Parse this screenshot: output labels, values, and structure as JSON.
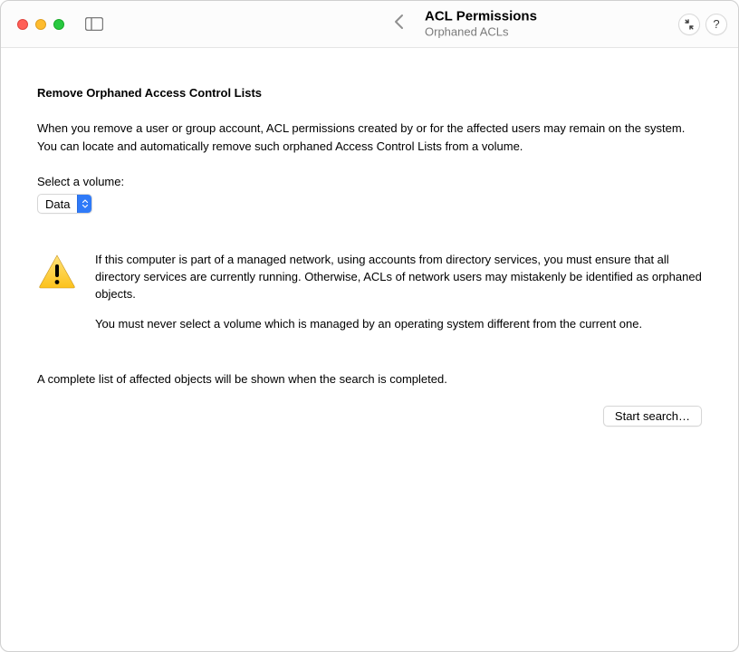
{
  "window": {
    "title": "ACL Permissions",
    "subtitle": "Orphaned ACLs"
  },
  "content": {
    "heading": "Remove Orphaned Access Control Lists",
    "intro": "When you remove a user or group account, ACL permissions created by or for the affected users may remain on the system. You can locate and automatically remove such orphaned Access Control Lists from a volume.",
    "select_label": "Select a volume:",
    "volume_selected": "Data",
    "warning_p1": "If this computer is part of a managed network, using accounts from directory services, you must ensure that all directory services are currently running. Otherwise, ACLs of network users may mistakenly be identified as orphaned objects.",
    "warning_p2": "You must never select a volume which is managed by an operating system different from the current one.",
    "status": "A complete list of affected objects will be shown when the search is completed.",
    "start_button": "Start search…"
  },
  "toolbar": {
    "help_label": "?"
  }
}
